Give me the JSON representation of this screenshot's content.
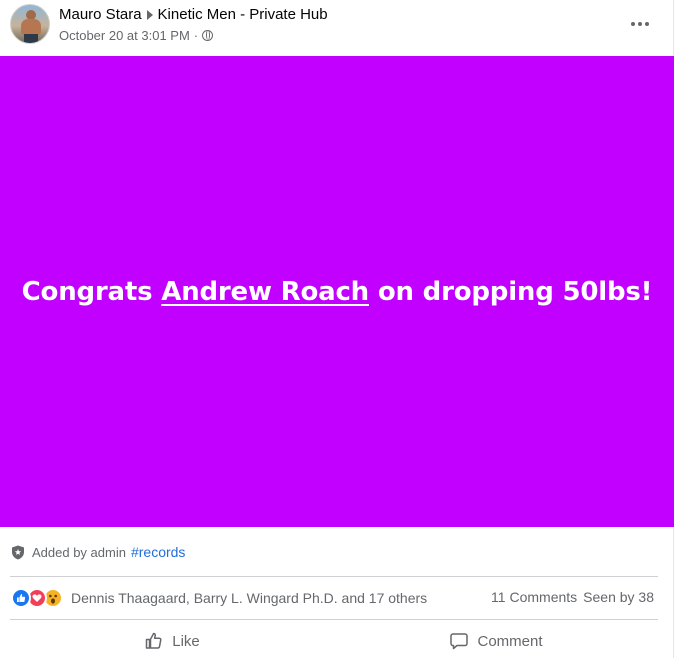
{
  "post": {
    "author": "Mauro Stara",
    "group": "Kinetic Men - Private Hub",
    "timestamp": "October 20 at 3:01 PM",
    "separator": "·",
    "privacy_icon": "globe-icon",
    "more_icon": "more-dots-icon"
  },
  "banner": {
    "background_color": "#c100ff",
    "text_before": "Congrats ",
    "mention": "Andrew Roach",
    "text_after": " on dropping 50lbs!"
  },
  "admin": {
    "icon": "shield-star-icon",
    "label": "Added by admin",
    "hashtag": "#records"
  },
  "engagement": {
    "reaction_icons": [
      "like-reaction-icon",
      "love-reaction-icon",
      "wow-reaction-icon"
    ],
    "reactors": "Dennis Thaagaard, Barry L. Wingard Ph.D. and 17 others",
    "comments": "11 Comments",
    "seen_by": "Seen by 38"
  },
  "actions": {
    "like_label": "Like",
    "comment_label": "Comment"
  },
  "colors": {
    "accent_blue": "#1877f2",
    "hashtag_blue": "#216fdb",
    "secondary_text": "#65676b"
  }
}
